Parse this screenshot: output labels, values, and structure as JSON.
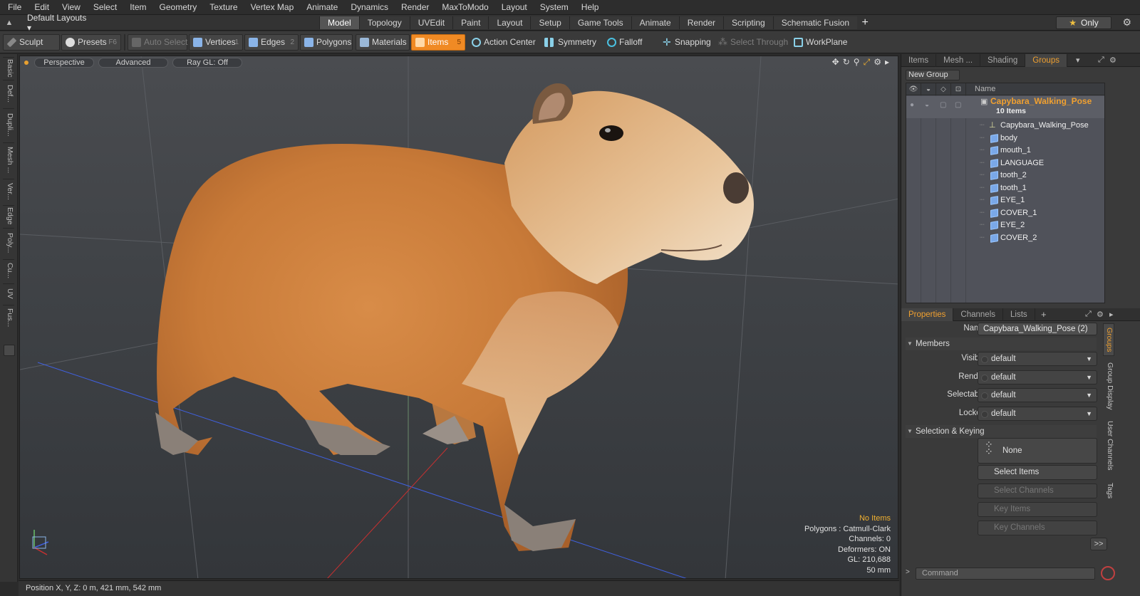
{
  "menu": [
    "File",
    "Edit",
    "View",
    "Select",
    "Item",
    "Geometry",
    "Texture",
    "Vertex Map",
    "Animate",
    "Dynamics",
    "Render",
    "MaxToModo",
    "Layout",
    "System",
    "Help"
  ],
  "layout": {
    "label": "Default Layouts",
    "tabs": [
      "Model",
      "Topology",
      "UVEdit",
      "Paint",
      "Layout",
      "Setup",
      "Game Tools",
      "Animate",
      "Render",
      "Scripting",
      "Schematic Fusion"
    ],
    "active_tab": "Model",
    "only_label": "Only"
  },
  "toolbar": {
    "sculpt": "Sculpt",
    "presets": "Presets",
    "presets_key": "F6",
    "auto_select": "Auto Select",
    "vertices": "Vertices",
    "vertices_key": "1",
    "edges": "Edges",
    "edges_key": "2",
    "polygons": "Polygons",
    "materials": "Materials",
    "items": "Items",
    "items_key": "5",
    "action_center": "Action Center",
    "symmetry": "Symmetry",
    "falloff": "Falloff",
    "snapping": "Snapping",
    "select_through": "Select Through",
    "workplane": "WorkPlane"
  },
  "left_tabs": [
    "Basic",
    "Def...",
    "Dupli...",
    "Mesh ...",
    "Ver...",
    "Edge",
    "Poly...",
    "Cu...",
    "UV",
    "Fus..."
  ],
  "viewport": {
    "view": "Perspective",
    "shading": "Advanced",
    "raygl": "Ray GL: Off",
    "info": {
      "no_items": "No Items",
      "polygons": "Polygons : Catmull-Clark",
      "channels": "Channels: 0",
      "deformers": "Deformers: ON",
      "gl": "GL: 210,688",
      "scale": "50 mm"
    }
  },
  "status": {
    "position": "Position X, Y, Z:  0 m, 421 mm, 542 mm"
  },
  "panel_tabs": [
    "Items",
    "Mesh ...",
    "Shading",
    "Groups"
  ],
  "active_panel_tab": "Groups",
  "groups": {
    "new_group": "New Group",
    "column_name": "Name",
    "group_name": "Capybara_Walking_Pose",
    "group_count": "10 Items",
    "items": [
      "Capybara_Walking_Pose",
      "body",
      "mouth_1",
      "LANGUAGE",
      "tooth_2",
      "tooth_1",
      "EYE_1",
      "COVER_1",
      "EYE_2",
      "COVER_2"
    ]
  },
  "prop_tabs": [
    "Properties",
    "Channels",
    "Lists"
  ],
  "properties": {
    "name_label": "Name",
    "name_value": "Capybara_Walking_Pose (2)",
    "members_section": "Members",
    "rows": [
      {
        "label": "Visible",
        "value": "default"
      },
      {
        "label": "Render",
        "value": "default"
      },
      {
        "label": "Selectable",
        "value": "default"
      },
      {
        "label": "Locked",
        "value": "default"
      }
    ],
    "selkey_section": "Selection & Keying",
    "none_button": "None",
    "select_items": "Select Items",
    "select_channels": "Select Channels",
    "key_items": "Key Items",
    "key_channels": "Key Channels",
    "more": ">>"
  },
  "side_tabs": [
    "Groups",
    "Group Display",
    "User Channels",
    "Tags"
  ],
  "command_placeholder": "Command",
  "colors": {
    "accent": "#f08a24",
    "group_text": "#f0a030",
    "viewport_bg": "#3f4246"
  }
}
